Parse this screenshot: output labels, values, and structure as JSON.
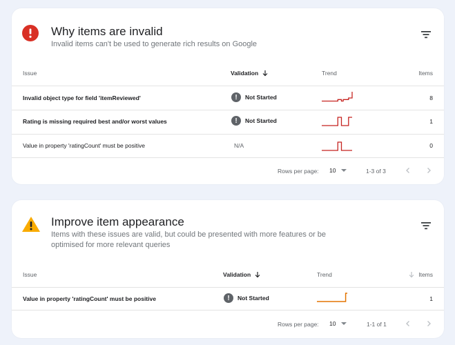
{
  "colors": {
    "error": "#d93025",
    "warning": "#f9ab00",
    "trend_error": "#c5221f",
    "trend_warning": "#e37400",
    "validation_icon": "#5f6368"
  },
  "invalid": {
    "title": "Why items are invalid",
    "subtitle": "Invalid items can't be used to generate rich results on Google",
    "icon": "error-circle-icon",
    "columns": {
      "issue": "Issue",
      "validation": "Validation",
      "trend": "Trend",
      "items": "Items"
    },
    "rows": [
      {
        "issue": "Invalid object type for field 'itemReviewed'",
        "validation": "Not Started",
        "items": "8",
        "trend": [
          2,
          2,
          2,
          2,
          2,
          2,
          2,
          2,
          2,
          3,
          3,
          2,
          3,
          3,
          3,
          4,
          4,
          8
        ]
      },
      {
        "issue": "Rating is missing required best and/or worst values",
        "validation": "Not Started",
        "items": "1",
        "trend": [
          0,
          0,
          0,
          0,
          0,
          0,
          0,
          0,
          0,
          1,
          1,
          0,
          0,
          0,
          0,
          1,
          1,
          1
        ]
      },
      {
        "issue": "Value in property 'ratingCount' must be positive",
        "validation": "N/A",
        "items": "0",
        "trend": [
          0,
          0,
          0,
          0,
          0,
          0,
          0,
          0,
          0,
          1,
          1,
          0,
          0,
          0,
          0,
          0,
          0,
          0
        ]
      }
    ],
    "footer": {
      "rows_per_page_label": "Rows per page:",
      "rows_per_page": "10",
      "range": "1-3 of 3"
    }
  },
  "improve": {
    "title": "Improve item appearance",
    "subtitle_line1": "Items with these issues are valid, but could be presented with more features or be",
    "subtitle_line2": "optimised for more relevant queries",
    "icon": "warning-triangle-icon",
    "columns": {
      "issue": "Issue",
      "validation": "Validation",
      "trend": "Trend",
      "items": "Items"
    },
    "rows": [
      {
        "issue": "Value in property 'ratingCount' must be positive",
        "validation": "Not Started",
        "items": "1",
        "trend": [
          0,
          0,
          0,
          0,
          0,
          0,
          0,
          0,
          0,
          0,
          0,
          0,
          0,
          0,
          0,
          0,
          0,
          1,
          1
        ]
      }
    ],
    "footer": {
      "rows_per_page_label": "Rows per page:",
      "rows_per_page": "10",
      "range": "1-1 of 1"
    }
  }
}
